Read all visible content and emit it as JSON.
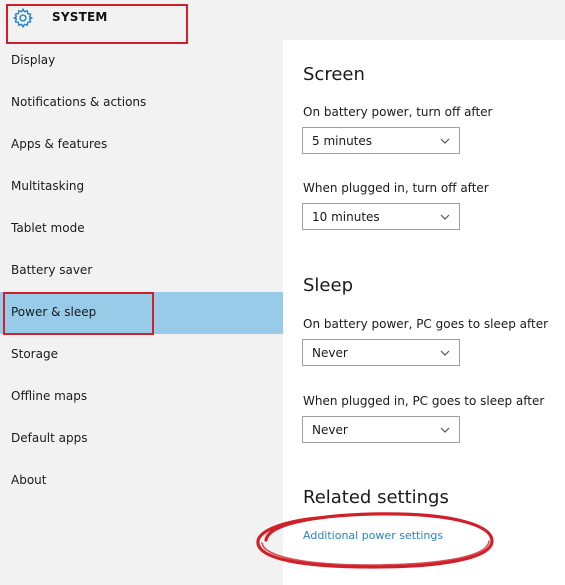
{
  "window": {
    "title": "SYSTEM",
    "icon": "gear-icon"
  },
  "sidebar": {
    "items": [
      {
        "label": "Display"
      },
      {
        "label": "Notifications & actions"
      },
      {
        "label": "Apps & features"
      },
      {
        "label": "Multitasking"
      },
      {
        "label": "Tablet mode"
      },
      {
        "label": "Battery saver"
      },
      {
        "label": "Power & sleep",
        "selected": true
      },
      {
        "label": "Storage"
      },
      {
        "label": "Offline maps"
      },
      {
        "label": "Default apps"
      },
      {
        "label": "About"
      }
    ]
  },
  "content": {
    "screen": {
      "title": "Screen",
      "battery_label": "On battery power, turn off after",
      "battery_value": "5 minutes",
      "plugged_label": "When plugged in, turn off after",
      "plugged_value": "10 minutes"
    },
    "sleep": {
      "title": "Sleep",
      "battery_label": "On battery power, PC goes to sleep after",
      "battery_value": "Never",
      "plugged_label": "When plugged in, PC goes to sleep after",
      "plugged_value": "Never"
    },
    "related": {
      "title": "Related settings",
      "link": "Additional power settings"
    }
  },
  "colors": {
    "sidebar_bg": "#f2f2f2",
    "selected_bg": "#97cbe8",
    "accent_link": "#2a84c4",
    "annotation_red": "#d0202a"
  }
}
